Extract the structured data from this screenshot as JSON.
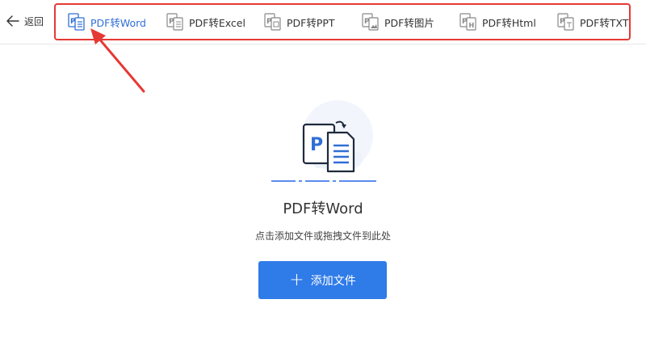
{
  "nav": {
    "back_label": "返回",
    "tabs": [
      {
        "label": "PDF转Word",
        "icon": "pdf-to-word-icon",
        "badge": "P",
        "active": true
      },
      {
        "label": "PDF转Excel",
        "icon": "pdf-to-excel-icon",
        "badge": "P",
        "active": false
      },
      {
        "label": "PDF转PPT",
        "icon": "pdf-to-ppt-icon",
        "badge": "P",
        "active": false
      },
      {
        "label": "PDF转图片",
        "icon": "pdf-to-image-icon",
        "badge": "P",
        "active": false
      },
      {
        "label": "PDF转Html",
        "icon": "pdf-to-html-icon",
        "badge": "P",
        "active": false
      },
      {
        "label": "PDF转TXT",
        "icon": "pdf-to-txt-icon",
        "badge": "P",
        "active": false
      }
    ]
  },
  "main": {
    "hero_badge": "P",
    "title": "PDF转Word",
    "hint": "点击添加文件或拖拽文件到此处",
    "add_button": {
      "plus": "+",
      "label": "添加文件"
    }
  },
  "colors": {
    "accent": "#2f7be8",
    "active_tab": "#2f6fd6",
    "annotation": "#e53935"
  }
}
